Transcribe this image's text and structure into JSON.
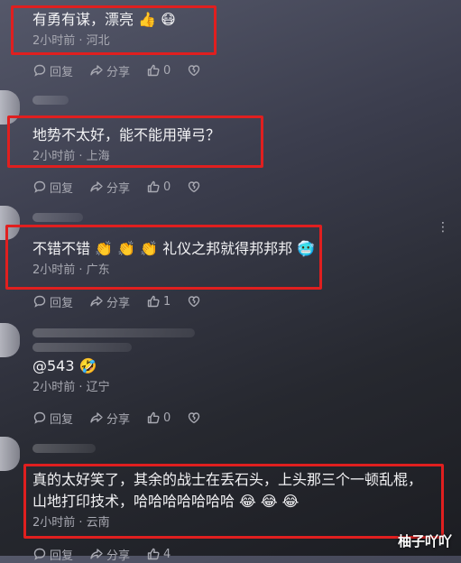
{
  "comments": [
    {
      "text": "有勇有谋，漂亮 👍 😷",
      "meta": "2小时前 · 河北",
      "reply": "回复",
      "share": "分享",
      "likes": "0"
    },
    {
      "text": "地势不太好，能不能用弹弓？",
      "meta": "2小时前 · 上海",
      "reply": "回复",
      "share": "分享",
      "likes": "0"
    },
    {
      "text": "不错不错 👏 👏 👏 礼仪之邦就得邦邦邦 🥶",
      "meta": "2小时前 · 广东",
      "reply": "回复",
      "share": "分享",
      "likes": "1"
    },
    {
      "text": "@543 🤣",
      "meta": "2小时前 · 辽宁",
      "reply": "回复",
      "share": "分享",
      "likes": "0"
    },
    {
      "text": "真的太好笑了，其余的战士在丢石头，上头那三个一顿乱棍，\n山地打印技术，哈哈哈哈哈哈哈 😂 😂 😂",
      "meta": "2小时前 · 云南",
      "reply": "回复",
      "share": "分享",
      "likes": "4"
    }
  ],
  "more_icon": "⋮",
  "watermark": "柚子吖吖",
  "colors": {
    "highlight_border": "#e01f1f",
    "meta_text": "#a8a9b2",
    "comment_text": "#f2f2f4"
  }
}
